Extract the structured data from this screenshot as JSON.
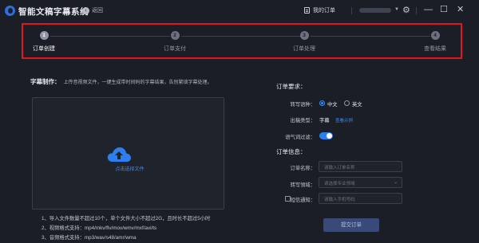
{
  "app": {
    "title": "智能文稿字幕系统",
    "back_label": "返回",
    "orders_label": "我的订单"
  },
  "window": {
    "minimize": "—",
    "maximize": "☐",
    "close": "✕"
  },
  "steps": [
    {
      "num": "1",
      "label": "订单创建"
    },
    {
      "num": "2",
      "label": "订单支付"
    },
    {
      "num": "3",
      "label": "订单处理"
    },
    {
      "num": "4",
      "label": "查看结果"
    }
  ],
  "left": {
    "heading": "字幕制作：",
    "hint": "上传音视频文件，一键生成带时间码的字幕结果，告别繁琐字幕处理。",
    "upload_label": "点击选择文件",
    "notes": [
      "1、导入文件数量不超过10个，单个文件大小不超过2G，且时长不超过5小时",
      "2、视频格式支持：mp4/mkv/flv/mov/wmv/mxf/avi/ts",
      "3、音频格式支持：mp3/wav/s48/amr/wma"
    ]
  },
  "right": {
    "requirements_title": "订单要求：",
    "lang_label": "转写语种：",
    "lang_options": [
      "中文",
      "英文"
    ],
    "output_label": "出稿类型：",
    "output_value": "字幕",
    "output_link": "查看示例",
    "filler_label": "语气词过滤：",
    "filler_on": true,
    "info_title": "订单信息：",
    "order_name_label": "订单名称：",
    "order_name_placeholder": "请输入订单名称",
    "domain_label": "转写领域：",
    "domain_placeholder": "请选择专业领域",
    "sms_label": "短信通知：",
    "sms_placeholder": "请输入手机号码",
    "submit_label": "提交订单"
  },
  "colors": {
    "accent": "#3c8cf0",
    "highlight_border": "#e0181c",
    "background": "#1b1e26"
  }
}
